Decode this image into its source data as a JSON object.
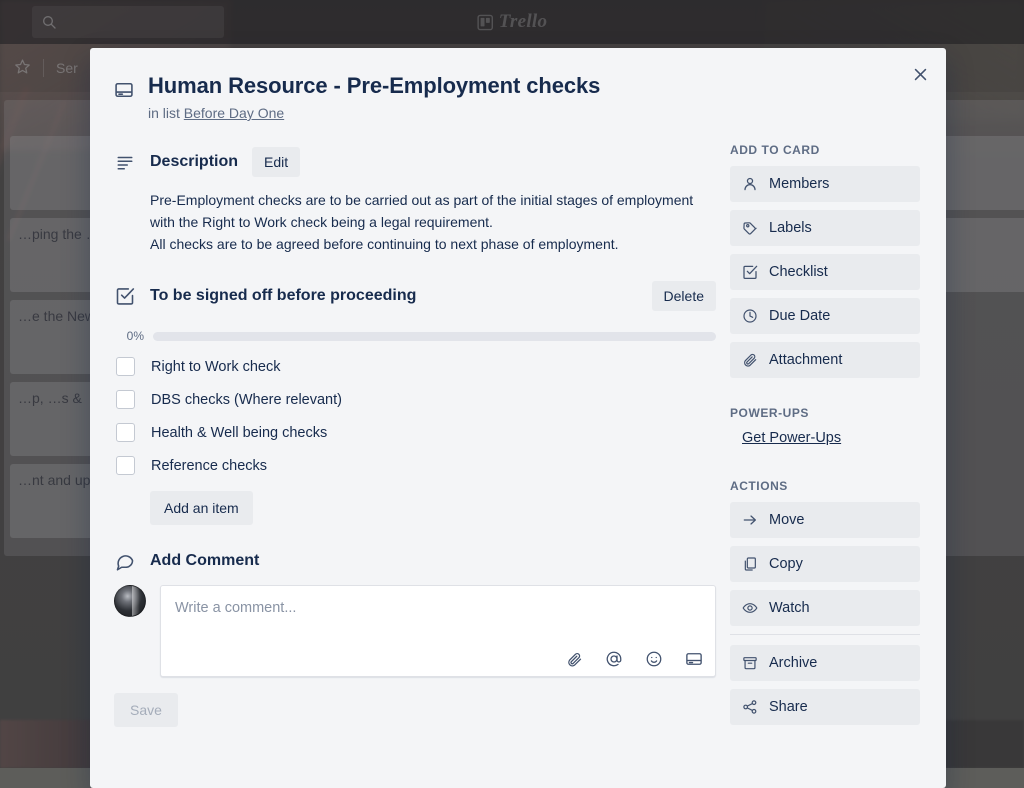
{
  "topbar": {
    "search_placeholder": "",
    "search_icon": "search-icon",
    "logo_text": "Trello"
  },
  "board_header": {
    "star_icon": "star-icon",
    "board_name": "Ser"
  },
  "board_lists": [
    {
      "menu": "…",
      "cards": [
        {
          "text": ""
        },
        {
          "text": "…ping the\n…progress"
        },
        {
          "text": "…e the New"
        },
        {
          "text": "…p,\n…s &"
        },
        {
          "text": "…nt and up\n…orking for\n…ncil"
        }
      ]
    },
    {
      "menu": "…",
      "cards": [
        {
          "text": ""
        },
        {
          "text": ""
        },
        {
          "text": ""
        },
        {
          "text": ""
        }
      ]
    },
    {
      "menu": "…",
      "cards": [
        {
          "text": ""
        },
        {
          "text": ""
        },
        {
          "text": ""
        }
      ]
    },
    {
      "menu": "…",
      "cards": [
        {
          "text": ""
        },
        {
          "text": ""
        }
      ]
    }
  ],
  "card": {
    "close_label": "✕",
    "title_icon": "card-icon",
    "title": "Human Resource - Pre-Employment checks",
    "in_list_prefix": "in list",
    "list_name": "Before Day One"
  },
  "description": {
    "icon": "description-icon",
    "title": "Description",
    "edit_label": "Edit",
    "text": "Pre-Employment checks are to be carried out as part of the initial stages of employment with the Right to Work check being a legal requirement.\nAll checks are to be agreed before continuing to next phase of employment."
  },
  "checklist": {
    "icon": "checklist-icon",
    "title": "To be signed off before proceeding",
    "delete_label": "Delete",
    "progress_label": "0%",
    "progress_value": 0,
    "items": [
      {
        "label": "Right to Work check",
        "checked": false
      },
      {
        "label": "DBS checks (Where relevant)",
        "checked": false
      },
      {
        "label": "Health & Well being checks",
        "checked": false
      },
      {
        "label": "Reference checks",
        "checked": false
      }
    ],
    "add_item_label": "Add an item"
  },
  "comment": {
    "icon": "comment-icon",
    "title": "Add Comment",
    "avatar": "user-avatar",
    "placeholder": "Write a comment...",
    "value": "",
    "toolbar_icons": [
      "attachment-icon",
      "mention-icon",
      "emoji-icon",
      "card-icon"
    ],
    "save_label": "Save"
  },
  "aside": {
    "add_to_card_heading": "ADD TO CARD",
    "add_to_card_items": [
      {
        "label": "Members",
        "icon": "member-icon"
      },
      {
        "label": "Labels",
        "icon": "label-icon"
      },
      {
        "label": "Checklist",
        "icon": "checklist-icon"
      },
      {
        "label": "Due Date",
        "icon": "clock-icon"
      },
      {
        "label": "Attachment",
        "icon": "attachment-icon"
      }
    ],
    "powerups_heading": "POWER-UPS",
    "powerups_link": "Get Power-Ups",
    "actions_heading": "ACTIONS",
    "actions_primary": [
      {
        "label": "Move",
        "icon": "arrow-right-icon"
      },
      {
        "label": "Copy",
        "icon": "copy-icon"
      },
      {
        "label": "Watch",
        "icon": "eye-icon"
      }
    ],
    "actions_secondary": [
      {
        "label": "Archive",
        "icon": "archive-icon"
      },
      {
        "label": "Share",
        "icon": "share-icon"
      }
    ]
  },
  "colors": {
    "modal_bg": "#f4f5f7",
    "button_bg": "#e9ebee",
    "text_primary": "#172b4d",
    "text_muted": "#5e6c84",
    "progress_track": "#e2e4ea",
    "progress_fill": "#5ba4cf"
  }
}
